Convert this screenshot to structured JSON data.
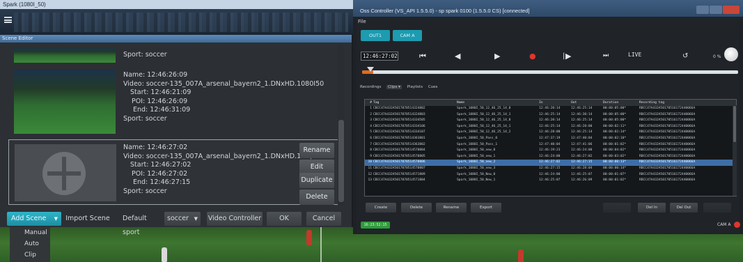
{
  "spark": {
    "title": "Spark (1080I_50)",
    "scene_editor_title": "Scene Editor"
  },
  "scenes": [
    {
      "sport": "Sport: soccer"
    },
    {
      "name": "Name: 12:46:26:09",
      "video": "Video: soccer-135_007A_arsenal_bayern2_1.DNxHD.1080I50",
      "start": "Start: 12:46:21:09",
      "poi": "POI: 12:46:26:09",
      "end": "End: 12:46:31:09",
      "sport": "Sport: soccer"
    },
    {
      "name": "Name: 12:46:27:02",
      "video": "Video: soccer-135_007A_arsenal_bayern2_1.DNxHD.108(",
      "start": "Start: 12:46:27:02",
      "poi": "POI: 12:46:27:02",
      "end": "End: 12:46:27:15",
      "sport": "Sport: soccer"
    }
  ],
  "scene_actions": {
    "rename": "Rename",
    "edit": "Edit",
    "duplicate": "Duplicate",
    "delete": "Delete"
  },
  "bottom_bar": {
    "add_scene": "Add Scene",
    "import_scene": "Import Scene",
    "default_sport_label": "Default sport",
    "default_sport_value": "soccer",
    "video_controller": "Video Controller",
    "ok": "OK",
    "cancel": "Cancel"
  },
  "add_scene_menu": [
    "Manual",
    "Auto",
    "Clip"
  ],
  "controller": {
    "title": "Oss Controller (VS_API 1.5.5.0) - sp spark 0100 (1.5.5.0 CS) [connected]",
    "menu_file": "File",
    "tabs": [
      "OUT1",
      "CAM A"
    ],
    "timecode": "12:46:27:02",
    "live_label": "LIVE",
    "speed": "0 %",
    "position_fraction": 0.015,
    "subtabs": [
      "Recordings",
      "Clips ▾",
      "Playlists",
      "Cues"
    ],
    "columns": [
      "#",
      "Tag",
      "Name",
      "In",
      "Out",
      "Duration",
      "Recording tag"
    ],
    "rows": [
      [
        "1",
        "CBCC47A432A5017070514324802",
        "Spark_1080I_50_12_46_25_14_0",
        "12:46:20:14",
        "12:46:25:14",
        "00:00:05:00*",
        "RBCC47A432A50170516172440066A"
      ],
      [
        "2",
        "CBCC47A432A5017070514324803",
        "Spark_1080I_50_12_46_25_14_1",
        "12:46:25:14",
        "12:46:30:14",
        "00:00:05:00*",
        "RBCC47A432A50170516172440066A"
      ],
      [
        "3",
        "CBCC47A432A5017070514334505",
        "Spark_1080I_50_12_46_25_14_0",
        "12:46:20:14",
        "12:46:25:14",
        "00:00:05:00*",
        "RBCC47A432A50170516172440066A"
      ],
      [
        "4",
        "CBCC47A432A5017070514334106",
        "Spark_1080I_50_12_46_25_14_1",
        "12:46:25:14",
        "12:46:28:00",
        "00:00:02:11*",
        "RBCC47A432A50170516172440066A"
      ],
      [
        "5",
        "CBCC47A432A5017070514334107",
        "Spark_1080I_50_12_46_25_14_2",
        "12:46:28:00",
        "12:46:25:14",
        "00:00:02:14*",
        "RBCC47A432A50170516172440066A"
      ],
      [
        "6",
        "CBCC47A432A5017070514363801",
        "Spark_1080I_50_Pass_0",
        "12:47:37:19",
        "12:47:40:04",
        "00:00:02:10*",
        "RBCC47A432A50170516172440066A"
      ],
      [
        "7",
        "CBCC47A432A5017070514363802",
        "Spark_1080I_50_Pass_1",
        "12:47:40:04",
        "12:47:41:06",
        "00:00:01:02*",
        "RBCC47A432A50170516172440066A"
      ],
      [
        "8",
        "CBCC47A432A5017070514570804",
        "Spark_1080I_50_new_0",
        "12:46:19:23",
        "12:46:24:00",
        "00:00:04:02*",
        "RBCC47A432A50170516172440066A"
      ],
      [
        "9",
        "CBCC47A432A5017070514570805",
        "Spark_1080I_50_new_1",
        "12:46:24:00",
        "12:46:27:02",
        "00:00:03:02*",
        "RBCC47A432A50170516172440066A"
      ],
      [
        "10",
        "CBCC47A432A5017070514570806",
        "Spark_1080I_50_new_2",
        "12:46:27:02",
        "12:46:27:15",
        "00:00:00:13*",
        "RBCC47A432A50170516172440066A"
      ],
      [
        "11",
        "CBCC47A432A5017070514570807",
        "Spark_1080I_50_new_3",
        "12:46:27:15",
        "12:46:28:04",
        "00:00:00:14*",
        "RBCC47A432A50170516172440066A"
      ],
      [
        "12",
        "CBCC47A432A5017070514571809",
        "Spark_1080I_50_New_0",
        "12:46:24:00",
        "12:46:25:07",
        "00:00:01:07*",
        "RBCC47A432A50170516172440066A"
      ],
      [
        "13",
        "CBCC47A432A5017070514571804",
        "Spark_1080I_50_New_1",
        "12:46:25:07",
        "12:46:26:09",
        "00:00:01:02*",
        "RBCC47A432A50170516172440066A"
      ]
    ],
    "selected_row": 9,
    "buttons_left": [
      "Create",
      "Delete",
      "Rename",
      "Export"
    ],
    "buttons_right": [
      "Del In",
      "Del Out"
    ],
    "status_timecode": "16:23:52:15",
    "cam_label": "CAM A"
  },
  "colors": {
    "accent": "#1d9bb0",
    "record": "#e0352b",
    "live_green": "#2f9b3b",
    "selection": "#3d6ea6"
  }
}
